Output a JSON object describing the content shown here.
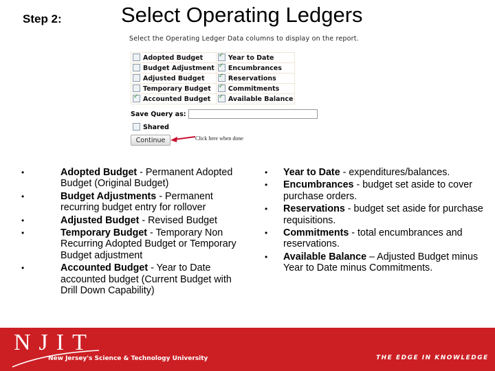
{
  "header": {
    "step_label": "Step 2:",
    "title": "Select Operating Ledgers"
  },
  "screenshot": {
    "intro": "Select the Operating Ledger Data columns to display on the report.",
    "checkboxes": [
      {
        "label": "Adopted Budget",
        "checked": false
      },
      {
        "label": "Year to Date",
        "checked": true
      },
      {
        "label": "Budget Adjustment",
        "checked": false
      },
      {
        "label": "Encumbrances",
        "checked": true
      },
      {
        "label": "Adjusted Budget",
        "checked": false
      },
      {
        "label": "Reservations",
        "checked": true
      },
      {
        "label": "Temporary Budget",
        "checked": false
      },
      {
        "label": "Commitments",
        "checked": true
      },
      {
        "label": "Accounted Budget",
        "checked": true
      },
      {
        "label": "Available Balance",
        "checked": true
      }
    ],
    "save_query_label": "Save Query as:",
    "save_query_value": "",
    "shared_label": "Shared",
    "shared_checked": false,
    "continue_label": "Continue",
    "hint": "Click here when done",
    "arrow_color": "#c8102e"
  },
  "left_list": [
    {
      "term": "Adopted Budget",
      "desc": " - Permanent Adopted Budget (Original Budget)"
    },
    {
      "term": "Budget Adjustments",
      "desc": " - Permanent recurring budget entry for rollover"
    },
    {
      "term": "Adjusted Budget",
      "desc": " - Revised Budget"
    },
    {
      "term": "Temporary Budget",
      "desc": " - Temporary Non Recurring Adopted Budget or Temporary Budget adjustment"
    },
    {
      "term": "Accounted Budget",
      "desc": " - Year to Date accounted budget (Current Budget with Drill Down Capability)"
    }
  ],
  "right_list": [
    {
      "term": "Year to Date",
      "desc": " - expenditures/balances."
    },
    {
      "term": "Encumbrances",
      "desc": " - budget set aside to cover purchase orders."
    },
    {
      "term": "Reservations",
      "desc": " - budget set aside for purchase requisitions."
    },
    {
      "term": "Commitments",
      "desc": " - total encumbrances and reservations."
    },
    {
      "term": "Available Balance",
      "desc": " – Adjusted Budget minus Year to Date minus Commitments."
    }
  ],
  "footer": {
    "logo": "NJIT",
    "university": "New Jersey's Science & Technology University",
    "slogan": "THE EDGE IN KNOWLEDGE",
    "brand_color": "#cc1f24"
  }
}
